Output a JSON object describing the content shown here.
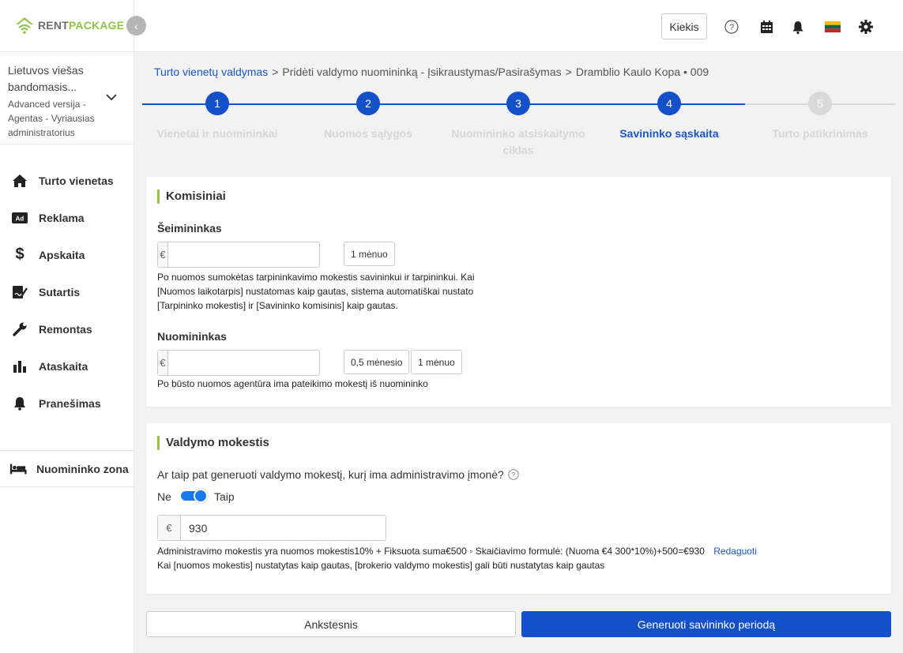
{
  "brand": {
    "part1": "RENT",
    "part2": "PACKAGE",
    "accent": "#8dc63f",
    "primary": "#1450c9"
  },
  "account": {
    "name": "Lietuvos viešas bandomasis...",
    "subtitle": "Advanced versija - Agentas - Vyriausias administratorius"
  },
  "nav": [
    {
      "label": "Turto vienetas",
      "icon": "home-icon"
    },
    {
      "label": "Reklama",
      "icon": "ad-icon"
    },
    {
      "label": "Apskaita",
      "icon": "dollar-icon"
    },
    {
      "label": "Sutartis",
      "icon": "contract-icon"
    },
    {
      "label": "Remontas",
      "icon": "wrench-icon"
    },
    {
      "label": "Ataskaita",
      "icon": "bar-chart-icon"
    },
    {
      "label": "Pranešimas",
      "icon": "bell-icon"
    }
  ],
  "tenant_zone": {
    "label": "Nuomininko zona",
    "icon": "bed-icon"
  },
  "header": {
    "kiekis_label": "Kiekis",
    "icons": [
      "help-icon",
      "calendar-icon",
      "notification-bell-icon",
      "lithuania-flag-icon",
      "settings-gear-icon"
    ]
  },
  "breadcrumb": {
    "link": "Turto vienetų valdymas",
    "middle": "Pridėti valdymo nuomininką - Įsikraustymas/Pasirašymas",
    "last": "Dramblio Kaulo Kopa • 009",
    "separator": ">"
  },
  "stepper": {
    "active_step": 4,
    "steps": [
      {
        "number": "1",
        "label": "Vienetai ir nuomininkai"
      },
      {
        "number": "2",
        "label": "Nuomos sąlygos"
      },
      {
        "number": "3",
        "label": "Nuomininko atsiskaitymo ciklas"
      },
      {
        "number": "4",
        "label": "Savininko sąskaita"
      },
      {
        "number": "5",
        "label": "Turto patikrinimas"
      }
    ]
  },
  "commission": {
    "title": "Komisiniai",
    "landlord": {
      "label": "Šeimininkas",
      "currency": "€",
      "value": "",
      "chips": [
        "1 mėnuo"
      ],
      "help": [
        "Po nuomos sumokėtas tarpininkavimo mokestis savininkui ir tarpininkui. Kai",
        "[Nuomos laikotarpis] nustatomas kaip gautas, sistema automatiškai nustato",
        "[Tarpininko mokestis] ir [Savininko komisinis] kaip gautas."
      ]
    },
    "tenant": {
      "label": "Nuomininkas",
      "currency": "€",
      "value": "",
      "chips": [
        "0,5 mėnesio",
        "1 mėnuo"
      ],
      "help": "Po būsto nuomos agentūra ima pateikimo mokestį iš nuomininko"
    }
  },
  "management_fee": {
    "title": "Valdymo mokestis",
    "question": "Ar taip pat generuoti valdymo mokestį, kurį ima administravimo įmonė?",
    "toggle_off_label": "Ne",
    "toggle_on_label": "Taip",
    "toggle_on": true,
    "currency": "€",
    "value": "930",
    "formula": "Administravimo mokestis yra nuomos mokestis10% + Fiksuota suma€500 ◦ Skaičiavimo formulė: (Nuoma €4 300*10%)+500=€930",
    "edit_link": "Redaguoti",
    "note": "Kai [nuomos mokestis] nustatytas kaip gautas, [brokerio valdymo mokestis] gali būti nustatytas kaip gautas"
  },
  "actions": {
    "prev_label": "Ankstesnis",
    "next_label": "Generuoti savininko periodą"
  }
}
